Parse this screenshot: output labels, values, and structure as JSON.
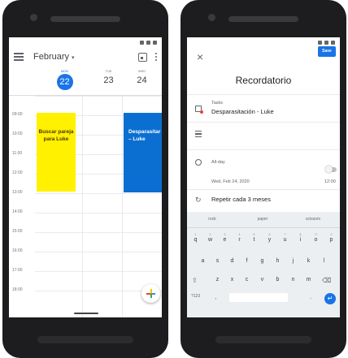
{
  "calendar": {
    "month": "February",
    "month_caret": "▾",
    "days": [
      {
        "name": "MON",
        "number": "22",
        "active": true
      },
      {
        "name": "TUE",
        "number": "23",
        "active": false
      },
      {
        "name": "WED",
        "number": "24",
        "active": false
      }
    ],
    "times": [
      "09:00",
      "10:00",
      "11:00",
      "12:00",
      "13:00",
      "14:00",
      "15:00",
      "16:00",
      "17:00",
      "18:00"
    ],
    "events": [
      {
        "title": "Buscar pareja para Luke",
        "color": "#fff100"
      },
      {
        "title": "Desparasitar – Luke",
        "color": "#0b6fd1"
      }
    ],
    "fab_colors": [
      "#4285f4",
      "#ea4335",
      "#fbbc05",
      "#34a853"
    ]
  },
  "reminder": {
    "close_icon": "×",
    "save_label": "Save",
    "title": "Recordatorio",
    "calendar_name": "Tasks",
    "task_title": "Desparasitación - Luke",
    "allday_label": "All-day",
    "date": "Wed, Feb 24, 2020",
    "time": "12:00",
    "repeat_label": "Repetir cada 3 meses",
    "repeat_icon": "↻"
  },
  "keyboard": {
    "suggestions": [
      "rock",
      "paper",
      "scissors"
    ],
    "row1": [
      "q",
      "w",
      "e",
      "r",
      "t",
      "y",
      "u",
      "i",
      "o",
      "p"
    ],
    "row1_digits": [
      "1",
      "2",
      "3",
      "4",
      "5",
      "6",
      "7",
      "8",
      "9",
      "0"
    ],
    "row2": [
      "a",
      "s",
      "d",
      "f",
      "g",
      "h",
      "j",
      "k",
      "l"
    ],
    "row3": [
      "z",
      "x",
      "c",
      "v",
      "b",
      "n",
      "m"
    ],
    "shift_icon": "⇧",
    "backspace_icon": "⌫",
    "symbols_label": "?123",
    "comma": ",",
    "period": ".",
    "enter_icon": "↵"
  },
  "colors": {
    "accent": "#1a73e8",
    "event_yellow": "#fff100",
    "event_blue": "#0b6fd1"
  }
}
